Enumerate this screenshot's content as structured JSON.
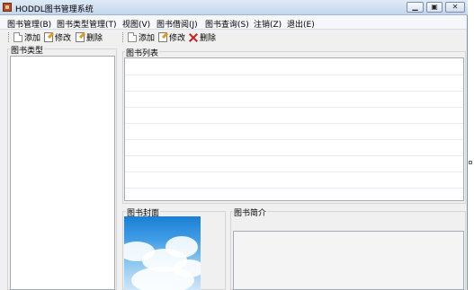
{
  "window": {
    "title": "HODDL图书管理系统"
  },
  "menu": {
    "items": [
      {
        "label": "图书管理(B)"
      },
      {
        "label": "图书类型管理(T)"
      },
      {
        "label": "视图(V)"
      },
      {
        "label": "图书借阅(J)"
      },
      {
        "label": "图书查询(S)"
      },
      {
        "label": "注销(Z)"
      },
      {
        "label": "退出(E)"
      }
    ]
  },
  "left_toolbar": {
    "add": "添加",
    "edit": "修改",
    "delete": "删除"
  },
  "right_toolbar": {
    "add": "添加",
    "edit": "修改",
    "delete": "删除"
  },
  "left_panel": {
    "title": "图书类型"
  },
  "book_list": {
    "title": "图书列表"
  },
  "cover_panel": {
    "title": "图书封面"
  },
  "intro_panel": {
    "title": "图书简介"
  },
  "icons": {
    "add": "new-page-icon",
    "edit": "edit-pencil-icon",
    "delete": "red-x-icon"
  }
}
